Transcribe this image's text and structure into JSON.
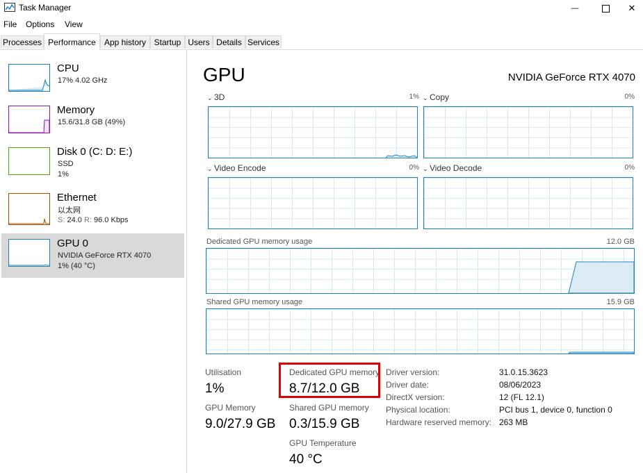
{
  "window": {
    "title": "Task Manager",
    "minimize_glyph": "—",
    "close_glyph": "✕"
  },
  "menu": [
    "File",
    "Options",
    "View"
  ],
  "tabs": [
    "Processes",
    "Performance",
    "App history",
    "Startup",
    "Users",
    "Details",
    "Services"
  ],
  "active_tab": "Performance",
  "sidebar": [
    {
      "name": "CPU",
      "line1": "17% 4.02 GHz",
      "line2": "",
      "color": "#117dbb"
    },
    {
      "name": "Memory",
      "line1": "15.6/31.8 GB (49%)",
      "line2": "",
      "color": "#8b12ae"
    },
    {
      "name": "Disk 0 (C: D: E:)",
      "line1": "SSD",
      "line2": "1%",
      "color": "#4da60c"
    },
    {
      "name": "Ethernet",
      "line1": "以太网",
      "line2": "",
      "send_label": "S:",
      "send_value": "24.0",
      "recv_label": "R:",
      "recv_value": "96.0 Kbps",
      "color": "#a74f01"
    },
    {
      "name": "GPU 0",
      "line1": "NVIDIA GeForce RTX 4070",
      "line2": "1% (40 °C)",
      "color": "#1f83b7"
    }
  ],
  "gpu": {
    "title": "GPU",
    "device_name": "NVIDIA GeForce RTX 4070",
    "engines": [
      {
        "label": "3D",
        "percent": "1%"
      },
      {
        "label": "Copy",
        "percent": "0%"
      },
      {
        "label": "Video Encode",
        "percent": "0%"
      },
      {
        "label": "Video Decode",
        "percent": "0%"
      }
    ],
    "dedicated_graph": {
      "label": "Dedicated GPU memory usage",
      "max": "12.0 GB"
    },
    "shared_graph": {
      "label": "Shared GPU memory usage",
      "max": "15.9 GB"
    },
    "stats": {
      "utilisation_label": "Utilisation",
      "utilisation_value": "1%",
      "gpu_memory_label": "GPU Memory",
      "gpu_memory_value": "9.0/27.9 GB",
      "dedicated_label": "Dedicated GPU memory",
      "dedicated_value": "8.7/12.0 GB",
      "shared_label": "Shared GPU memory",
      "shared_value": "0.3/15.9 GB",
      "temp_label": "GPU Temperature",
      "temp_value": "40 °C"
    },
    "info": [
      {
        "label": "Driver version:",
        "value": "31.0.15.3623"
      },
      {
        "label": "Driver date:",
        "value": "08/06/2023"
      },
      {
        "label": "DirectX version:",
        "value": "12 (FL 12.1)"
      },
      {
        "label": "Physical location:",
        "value": "PCI bus 1, device 0, function 0"
      },
      {
        "label": "Hardware reserved memory:",
        "value": "263 MB"
      }
    ]
  }
}
